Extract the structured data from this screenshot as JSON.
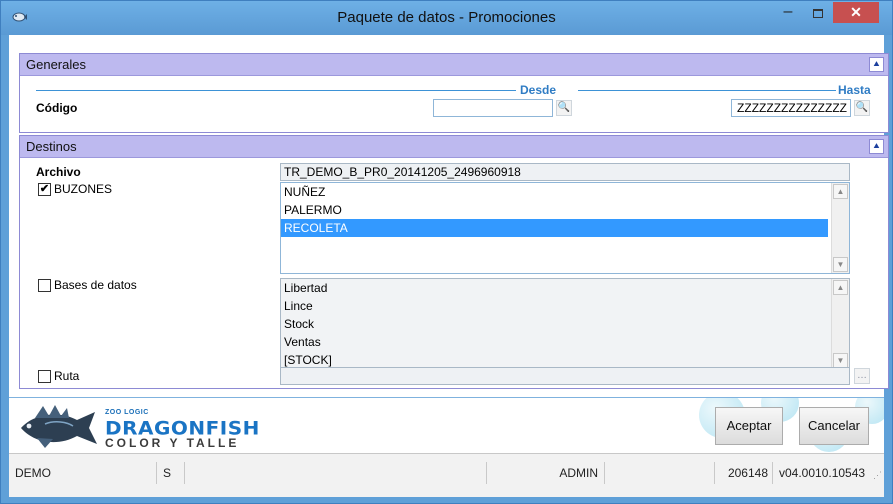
{
  "window": {
    "title": "Paquete de datos - Promociones",
    "minimize_glyph": "–",
    "close_glyph": "✕",
    "accent_color": "#5fa0d8",
    "close_color": "#c75050"
  },
  "generales": {
    "title": "Generales",
    "collapse_glyph": "⯅",
    "desde_label": "Desde",
    "hasta_label": "Hasta",
    "codigo_label": "Código",
    "codigo_desde_value": "",
    "codigo_hasta_value": "ZZZZZZZZZZZZZZZ",
    "lookup_glyph": "🔍"
  },
  "destinos": {
    "title": "Destinos",
    "collapse_glyph": "⯅",
    "archivo_label": "Archivo",
    "archivo_value": "TR_DEMO_B_PR0_20141205_2496960918",
    "buzones": {
      "label": "BUZONES",
      "checked": true,
      "check_glyph": "✔",
      "items": [
        "NUÑEZ",
        "PALERMO",
        "RECOLETA"
      ],
      "selected": "RECOLETA"
    },
    "bases": {
      "label": "Bases de datos",
      "checked": false,
      "items": [
        "Libertad",
        "Lince",
        "Stock",
        "Ventas",
        "[STOCK]"
      ]
    },
    "ruta": {
      "label": "Ruta",
      "checked": false,
      "value": "",
      "browse_glyph": "…"
    },
    "scroll_up_glyph": "▲",
    "scroll_down_glyph": "▼"
  },
  "footer": {
    "logo_brand": "ZOO LOGIC",
    "logo_product": "DRAGONFISH",
    "logo_tagline": "COLOR Y TALLE",
    "accept_label": "Aceptar",
    "cancel_label": "Cancelar"
  },
  "status": {
    "company": "DEMO",
    "mode": "S",
    "user": "ADMIN",
    "number": "206148",
    "version": "v04.0010.10543",
    "grip": "⋰"
  }
}
